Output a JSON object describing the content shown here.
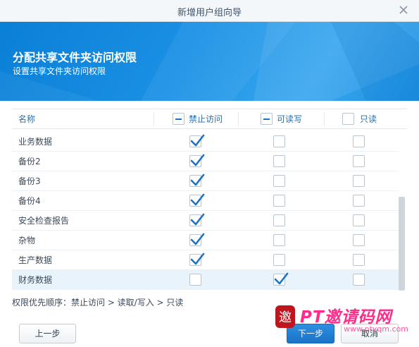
{
  "window": {
    "title": "新增用户组向导"
  },
  "banner": {
    "heading": "分配共享文件夹访问权限",
    "subheading": "设置共享文件夹访问权限"
  },
  "table": {
    "columns": {
      "name": "名称",
      "deny": "禁止访问",
      "readwrite": "可读写",
      "readonly": "只读"
    },
    "header_state": {
      "deny": "partial",
      "readwrite": "partial",
      "readonly": "unchecked"
    },
    "rows": [
      {
        "name": "业务数据",
        "deny": true,
        "readwrite": false,
        "readonly": false
      },
      {
        "name": "备份2",
        "deny": true,
        "readwrite": false,
        "readonly": false
      },
      {
        "name": "备份3",
        "deny": true,
        "readwrite": false,
        "readonly": false
      },
      {
        "name": "备份4",
        "deny": true,
        "readwrite": false,
        "readonly": false
      },
      {
        "name": "安全检查报告",
        "deny": true,
        "readwrite": false,
        "readonly": false
      },
      {
        "name": "杂物",
        "deny": true,
        "readwrite": false,
        "readonly": false
      },
      {
        "name": "生产数据",
        "deny": true,
        "readwrite": false,
        "readonly": false
      },
      {
        "name": "财务数据",
        "deny": false,
        "readwrite": true,
        "readonly": false
      }
    ],
    "selected_row": 7
  },
  "priority_text": "权限优先顺序：禁止访问 > 读取/写入 > 只读",
  "buttons": {
    "prev": "上一步",
    "next": "下一步",
    "cancel": "取消"
  },
  "watermark": {
    "brand": "PT邀请码网",
    "site": "www.ptyqm.com",
    "seal": "邀"
  },
  "colors": {
    "accent": "#1a73c8",
    "banner": "#1b91e5",
    "check": "#1a72c9"
  }
}
